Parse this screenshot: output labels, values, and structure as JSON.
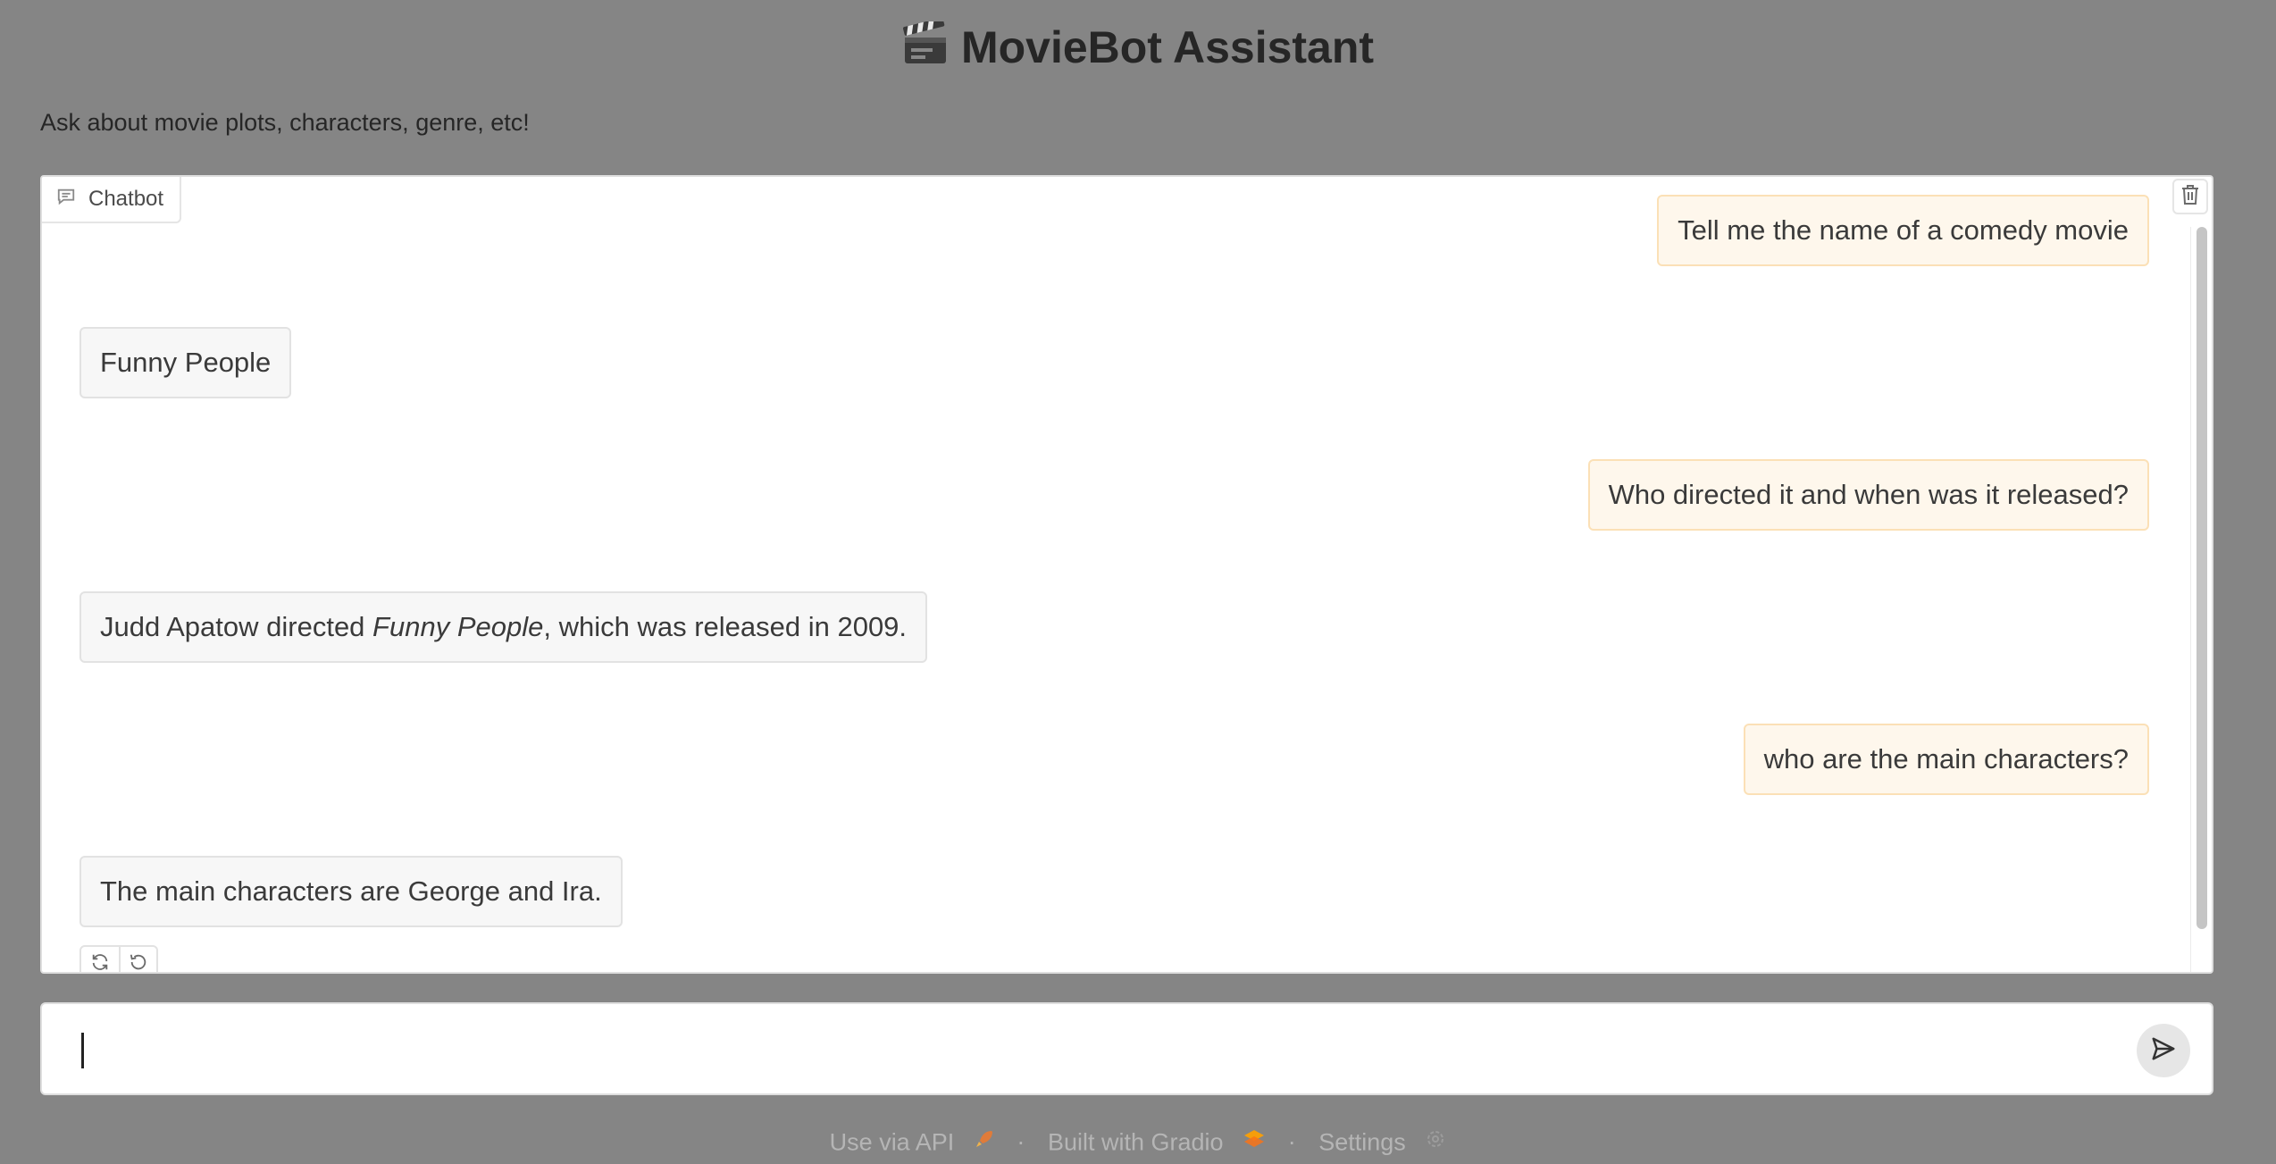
{
  "app": {
    "title": "MovieBot Assistant",
    "description": "Ask about movie plots, characters, genre, etc!"
  },
  "chatbot": {
    "label": "Chatbot",
    "messages": [
      {
        "role": "user",
        "text": "Tell me the name of a comedy movie"
      },
      {
        "role": "bot",
        "text": "Funny People"
      },
      {
        "role": "user",
        "text": "Who directed it and when was it released?"
      },
      {
        "role": "bot",
        "text_before": "Judd Apatow directed ",
        "text_italic": "Funny People",
        "text_after": ", which was released in 2009."
      },
      {
        "role": "user",
        "text": "who are the main characters?"
      },
      {
        "role": "bot",
        "text": "The main characters are George and Ira."
      }
    ]
  },
  "input": {
    "value": "",
    "placeholder": ""
  },
  "footer": {
    "api_label": "Use via API",
    "built_label": "Built with Gradio",
    "settings_label": "Settings",
    "separator": "·"
  },
  "colors": {
    "background": "#858585",
    "user_bubble": "#fef7ec",
    "user_border": "#fbe0b6",
    "bot_bubble": "#f7f7f7"
  }
}
